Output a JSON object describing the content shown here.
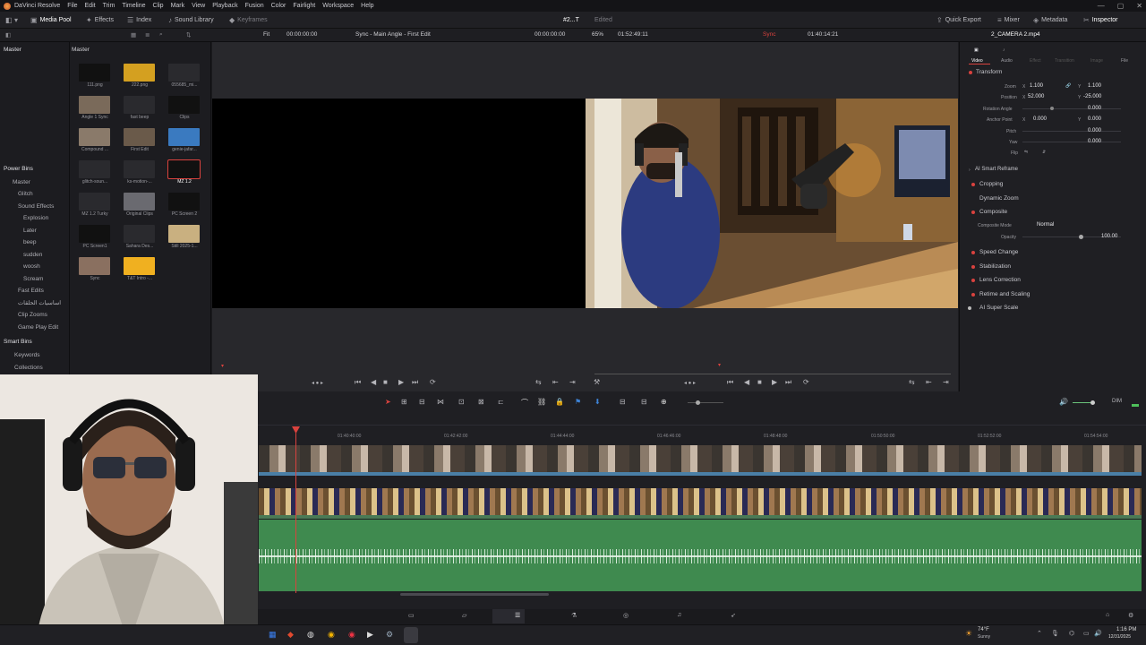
{
  "menubar": {
    "app": "DaVinci Resolve",
    "items": [
      "File",
      "Edit",
      "Trim",
      "Timeline",
      "Clip",
      "Mark",
      "View",
      "Playback",
      "Fusion",
      "Color",
      "Fairlight",
      "Workspace",
      "Help"
    ]
  },
  "toolbar": {
    "media_pool": "Media Pool",
    "effects": "Effects",
    "index": "Index",
    "sound_library": "Sound Library",
    "keyframes": "Keyframes",
    "project": "#2...T",
    "status": "Edited",
    "quick_export": "Quick Export",
    "mixer": "Mixer",
    "metadata": "Metadata",
    "inspector": "Inspector"
  },
  "subbar": {
    "fit": "Fit",
    "src_tc": "00:00:00:00",
    "timeline_name": "Sync - Main Angle - First Edit",
    "tc2": "00:00:00:00",
    "zoom": "65%",
    "tc3": "01:52:49:11",
    "sync": "Sync",
    "tc4": "01:40:14:21",
    "clip_name": "2_CAMERA 2.mp4"
  },
  "leftpane": {
    "master": "Master",
    "power_bins": "Power Bins",
    "pb_items": [
      "Master",
      "Glitch",
      "Sound Effects",
      "Explosion",
      "Later",
      "beep",
      "sudden",
      "woosh",
      "Scream",
      "Fast Edits",
      "اساسيات الحلقات",
      "Clip Zooms",
      "Game Play Edit"
    ],
    "smart_bins": "Smart Bins",
    "sm_items": [
      "Keywords",
      "Collections"
    ]
  },
  "mediapool": {
    "header": "Master",
    "clips": [
      "111.png",
      "222.png",
      "055685_mi...",
      "Angle 1 Sync",
      "fast beep",
      "Clips",
      "Compound ...",
      "First Edit",
      "genie-jafar...",
      "glitch-soun...",
      "ks-motion-...",
      "MZ 1.2",
      "MZ 1.2 Turky",
      "Original Clips",
      "PC Screen 2",
      "PC Screen1",
      "Sahara Des...",
      "Still 2025-1...",
      "Sync",
      "T&T Intro -..."
    ]
  },
  "inspector": {
    "tabs": [
      "Video",
      "Audio",
      "Effect",
      "Transition",
      "Image",
      "File"
    ],
    "transform": "Transform",
    "zoom_label": "Zoom",
    "zoom_x": "1.100",
    "zoom_y": "1.100",
    "position_label": "Position",
    "pos_x": "52.000",
    "pos_y": "-25.000",
    "rotation_label": "Rotation Angle",
    "rotation": "0.000",
    "anchor_label": "Anchor Point",
    "anchor_x": "0.000",
    "anchor_y": "0.000",
    "pitch_label": "Pitch",
    "pitch": "0.000",
    "yaw_label": "Yaw",
    "yaw": "0.000",
    "flip_label": "Flip",
    "smart_reframe": "AI Smart Reframe",
    "cropping": "Cropping",
    "dynamic_zoom": "Dynamic Zoom",
    "composite": "Composite",
    "comp_mode_label": "Composite Mode",
    "comp_mode": "Normal",
    "opacity_label": "Opacity",
    "opacity": "100.00",
    "speed_change": "Speed Change",
    "stabilization": "Stabilization",
    "lens_correction": "Lens Correction",
    "retime": "Retime and Scaling",
    "super_scale": "AI Super Scale"
  },
  "timeline": {
    "ruler": [
      "01:40:40:00",
      "01:42:42:00",
      "01:44:44:00",
      "01:46:46:00",
      "01:48:48:00",
      "01:50:50:00",
      "01:52:52:00",
      "01:54:54:00"
    ],
    "dim": "DIM"
  },
  "taskbar": {
    "weather": "74°F",
    "weather_sub": "Sunny",
    "time": "1:16 PM",
    "date": "12/31/2025"
  },
  "colors": {
    "accent": "#d9423e",
    "audio": "#4a9a5a",
    "video_track": "#4a7fa6"
  }
}
